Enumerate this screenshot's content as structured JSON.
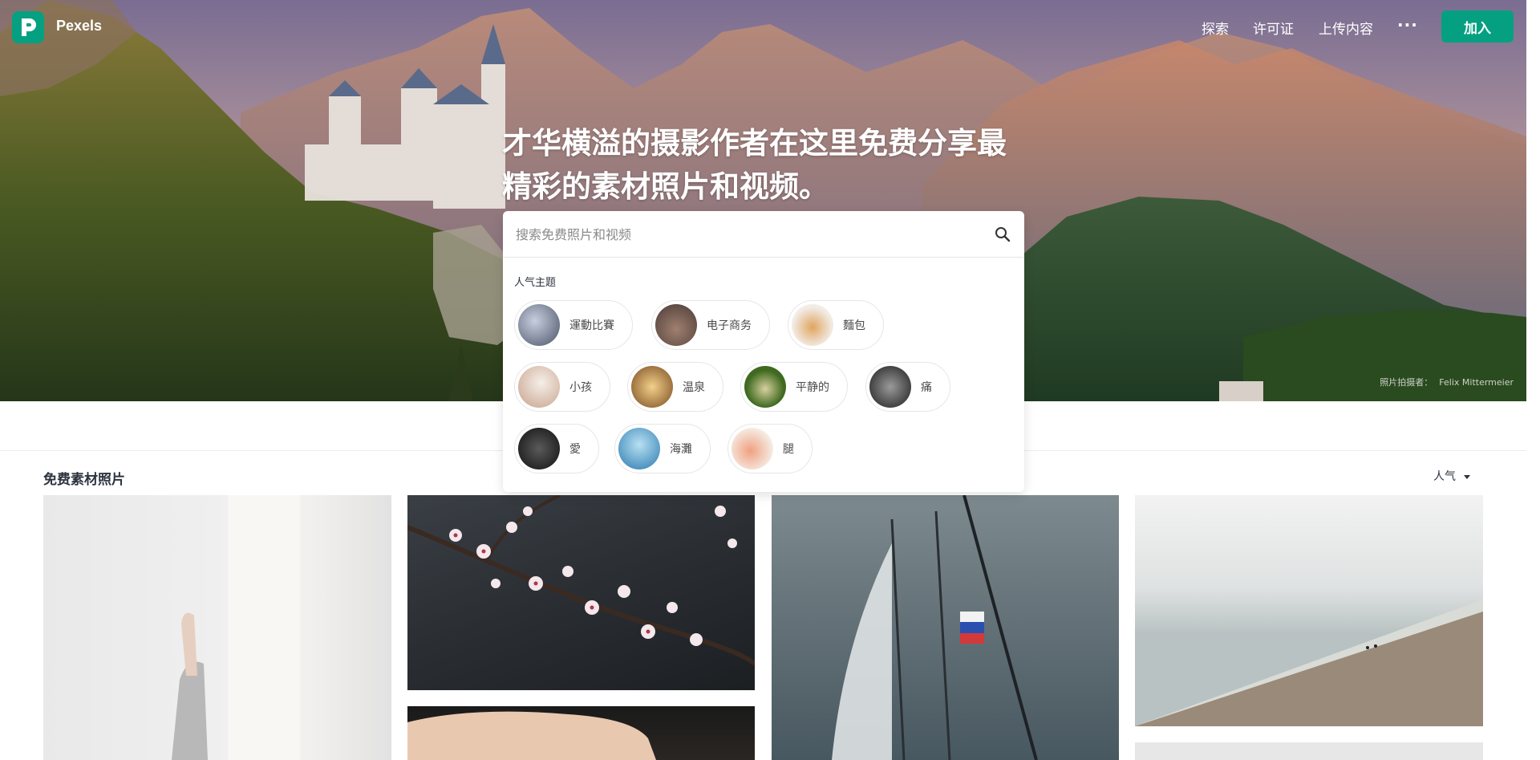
{
  "brand": {
    "name": "Pexels",
    "color": "#05a081"
  },
  "nav": {
    "links": [
      "探索",
      "许可证",
      "上传内容"
    ],
    "more": "···",
    "join": "加入"
  },
  "hero": {
    "headline": "才华横溢的摄影作者在这里免费分享最精彩的素材照片和视频。",
    "credit_label": "照片拍摄者：",
    "credit_name": "Felix Mittermeier"
  },
  "search": {
    "placeholder": "搜索免费照片和视频",
    "icon": "search-icon",
    "topics_title": "人气主题",
    "topics": [
      {
        "label": "運動比賽",
        "color": "#6a7a92"
      },
      {
        "label": "电子商务",
        "color": "#8a7060"
      },
      {
        "label": "麵包",
        "color": "#d9a060"
      },
      {
        "label": "小孩",
        "color": "#e8dcd0"
      },
      {
        "label": "温泉",
        "color": "#c08a40"
      },
      {
        "label": "平静的",
        "color": "#5c8030"
      },
      {
        "label": "痛",
        "color": "#3a3a3a"
      },
      {
        "label": "愛",
        "color": "#2a2a2a"
      },
      {
        "label": "海灘",
        "color": "#3a9ad0"
      },
      {
        "label": "腿",
        "color": "#e07a60"
      }
    ]
  },
  "content": {
    "section_title": "免费素材照片",
    "sort_label": "人气"
  }
}
